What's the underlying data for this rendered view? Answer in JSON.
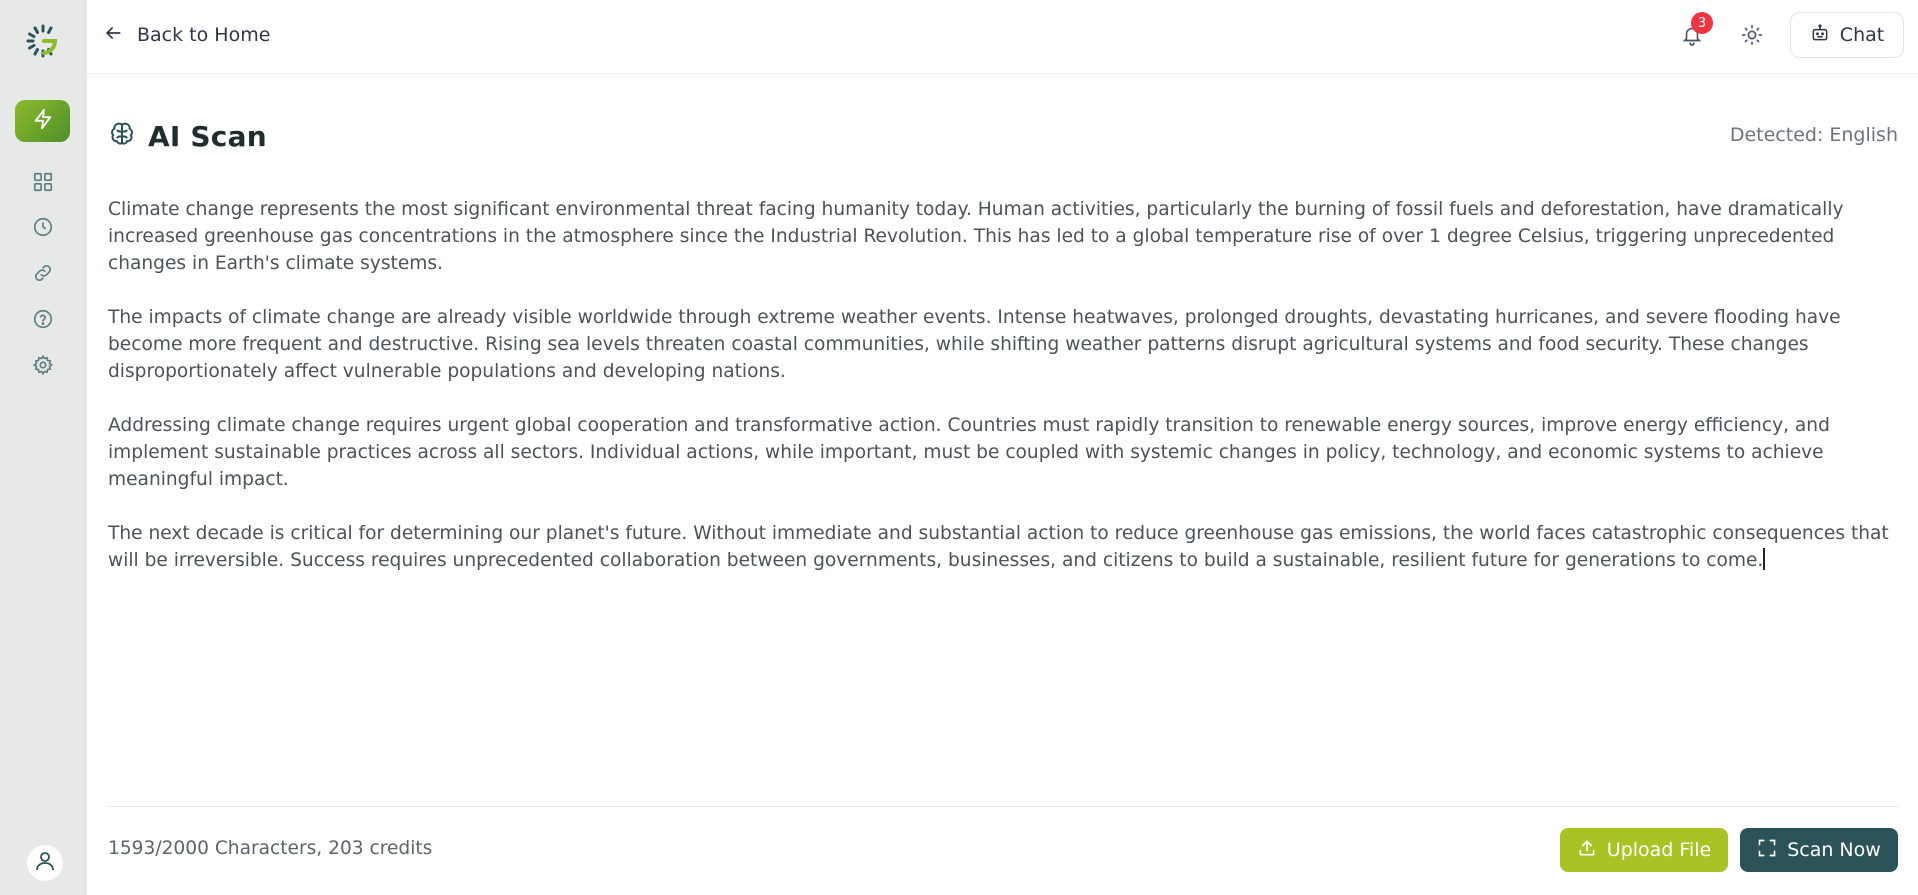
{
  "topbar": {
    "back_label": "Back to Home",
    "notification_count": "3",
    "chat_label": "Chat"
  },
  "page": {
    "title": "AI Scan",
    "detected_language": "Detected: English"
  },
  "editor": {
    "paragraphs": [
      "Climate change represents the most significant environmental threat facing humanity today. Human activities, particularly the burning of fossil fuels and deforestation, have dramatically increased greenhouse gas concentrations in the atmosphere since the Industrial Revolution. This has led to a global temperature rise of over 1 degree Celsius, triggering unprecedented changes in Earth's climate systems.",
      "The impacts of climate change are already visible worldwide through extreme weather events. Intense heatwaves, prolonged droughts, devastating hurricanes, and severe flooding have become more frequent and destructive. Rising sea levels threaten coastal communities, while shifting weather patterns disrupt agricultural systems and food security. These changes disproportionately affect vulnerable populations and developing nations.",
      "Addressing climate change requires urgent global cooperation and transformative action. Countries must rapidly transition to renewable energy sources, improve energy efficiency, and implement sustainable practices across all sectors. Individual actions, while important, must be coupled with systemic changes in policy, technology, and economic systems to achieve meaningful impact.",
      "The next decade is critical for determining our planet's future. Without immediate and substantial action to reduce greenhouse gas emissions, the world faces catastrophic consequences that will be irreversible. Success requires unprecedented collaboration between governments, businesses, and citizens to build a sustainable, resilient future for generations to come."
    ]
  },
  "footer": {
    "stats": "1593/2000 Characters,  203 credits",
    "upload_label": "Upload File",
    "scan_label": "Scan Now"
  },
  "sidebar": {
    "items": [
      {
        "icon": "lightning-icon",
        "active": true
      },
      {
        "icon": "grid-icon"
      },
      {
        "icon": "clock-icon"
      },
      {
        "icon": "link-icon"
      },
      {
        "icon": "help-icon"
      },
      {
        "icon": "gear-icon"
      }
    ]
  },
  "colors": {
    "accent_green": "#a8c323",
    "dark_teal": "#2b5358",
    "badge_red": "#ef3340",
    "sidebar_bg": "#e6e9e8"
  }
}
